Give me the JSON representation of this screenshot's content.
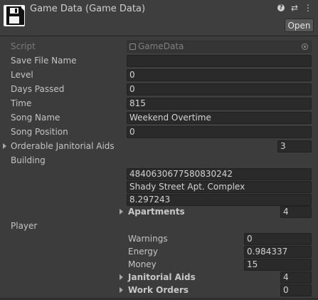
{
  "header": {
    "title": "Game Data (Game Data)",
    "open_label": "Open",
    "icons": [
      "floppy-disk-icon",
      "help-icon",
      "preset-settings-icon",
      "kebab-menu-icon"
    ]
  },
  "script": {
    "label": "Script",
    "value": "GameData"
  },
  "fields": [
    {
      "label": "Save File Name",
      "value": ""
    },
    {
      "label": "Level",
      "value": "0"
    },
    {
      "label": "Days Passed",
      "value": "0"
    },
    {
      "label": "Time",
      "value": "815"
    },
    {
      "label": "Song Name",
      "value": "Weekend Overtime"
    },
    {
      "label": "Song Position",
      "value": "0"
    }
  ],
  "orderable": {
    "label": "Orderable Janitorial Aids",
    "count": "3"
  },
  "building": {
    "label": "Building",
    "values": [
      "4840630677580830242",
      "Shady Street Apt. Complex",
      "8.297243"
    ],
    "apartments": {
      "label": "Apartments",
      "count": "4"
    }
  },
  "player": {
    "label": "Player",
    "warnings": {
      "label": "Warnings",
      "value": "0"
    },
    "energy": {
      "label": "Energy",
      "value": "0.984337"
    },
    "money": {
      "label": "Money",
      "value": "15"
    },
    "janitorial_aids": {
      "label": "Janitorial Aids",
      "count": "4"
    },
    "work_orders": {
      "label": "Work Orders",
      "count": "0"
    }
  }
}
